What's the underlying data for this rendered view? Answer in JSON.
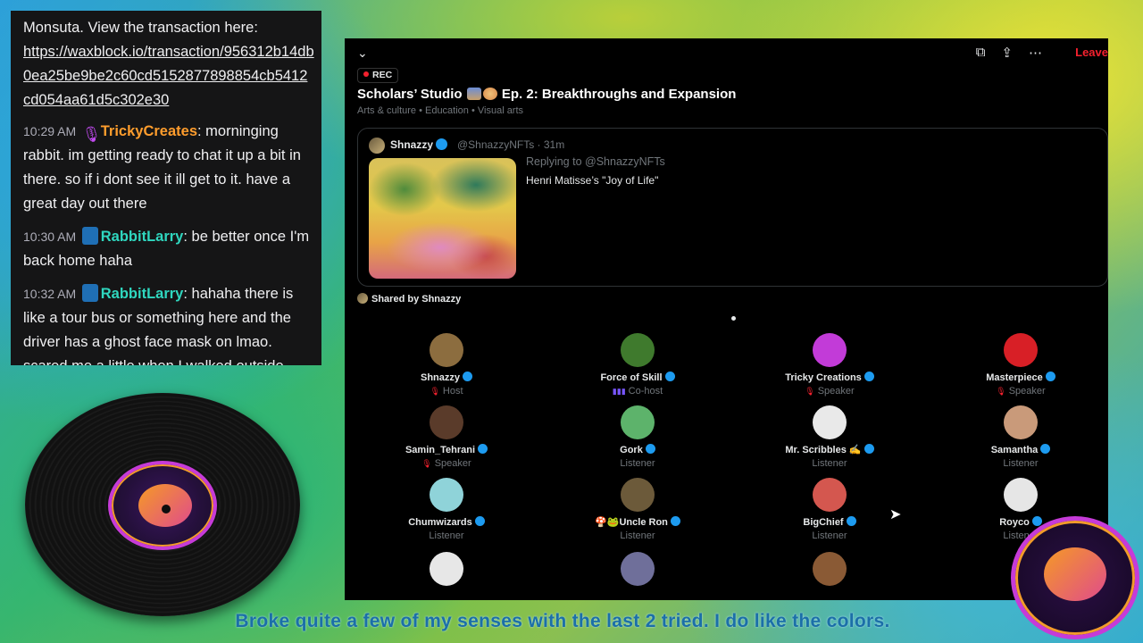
{
  "chat": {
    "messages": [
      {
        "time": "",
        "user": "",
        "text": "Monsuta. View the transaction here:",
        "link": "https://waxblock.io/transaction/956312b14db0ea25be9be2c60cd5152877898854cb5412cd054aa61d5c302e30"
      },
      {
        "time": "10:29 AM",
        "user": "TrickyCreates",
        "text": ": morninging rabbit. im getting ready to chat it up a bit in there. so if i dont see it ill get to it. have a great day out there"
      },
      {
        "time": "10:30 AM",
        "user": "RabbitLarry",
        "text": ": be better once I'm back home haha"
      },
      {
        "time": "10:32 AM",
        "user": "RabbitLarry",
        "text": ": hahaha there is like a tour bus or something here and the driver has a ghost face mask on lmao. scared me a little when I walked outside"
      }
    ]
  },
  "space": {
    "leave_label": "Leave",
    "rec_label": "REC",
    "title_part1": "Scholars’ Studio",
    "title_part2": "Ep. 2: Breakthroughs and Expansion",
    "categories": "Arts & culture • Education • Visual arts",
    "tweet": {
      "author": "Shnazzy",
      "handle_time": "@ShnazzyNFTs · 31m",
      "reply": "Replying to @ShnazzyNFTs",
      "body": "Henri Matisse’s \"Joy of Life\""
    },
    "shared_by": "Shared by Shnazzy",
    "participants": [
      {
        "name": "Shnazzy",
        "role": "Host",
        "color": "#8c6d3f"
      },
      {
        "name": "Force of Skill",
        "role": "Co-host",
        "color": "#3f7a2d"
      },
      {
        "name": "Tricky Creations",
        "role": "Speaker",
        "color": "#c23bd8"
      },
      {
        "name": "Masterpiece",
        "role": "Speaker",
        "color": "#d81f26"
      },
      {
        "name": "Samin_Tehrani",
        "role": "Speaker",
        "color": "#5a3b2a"
      },
      {
        "name": "Gork",
        "role": "Listener",
        "color": "#5db36b"
      },
      {
        "name": "Mr. Scribbles ✍",
        "role": "Listener",
        "color": "#e9e9e9"
      },
      {
        "name": "Samantha",
        "role": "Listener",
        "color": "#c99a7a"
      },
      {
        "name": "Chumwizards",
        "role": "Listener",
        "color": "#8fd3d9"
      },
      {
        "name": "🍄🐸Uncle Ron",
        "role": "Listener",
        "color": "#6c5a3a"
      },
      {
        "name": "BigChief",
        "role": "Listener",
        "color": "#d4574f"
      },
      {
        "name": "Royco",
        "role": "Listener",
        "color": "#e6e6e6"
      }
    ]
  },
  "subtitle": "Broke quite a few of my senses with the last 2 tried. I do like the colors."
}
